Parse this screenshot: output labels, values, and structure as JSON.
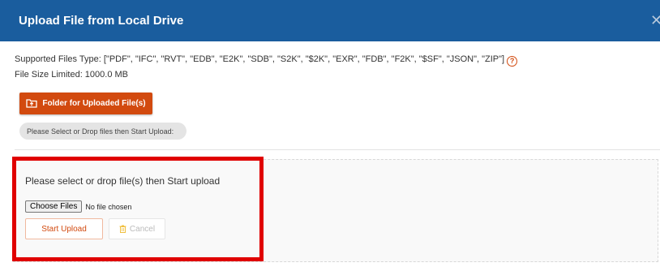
{
  "dialog": {
    "title": "Upload File from Local Drive",
    "close_glyph": "✕"
  },
  "info": {
    "supported_types": "Supported Files Type: [\"PDF\", \"IFC\", \"RVT\", \"EDB\", \"E2K\", \"SDB\", \"S2K\", \"$2K\", \"EXR\", \"FDB\", \"F2K\", \"$SF\", \"JSON\", \"ZIP\"]",
    "size_limit": "File Size Limited: 1000.0 MB",
    "help_glyph": "?"
  },
  "toolbar": {
    "folder_label": "Folder for Uploaded File(s)",
    "select_hint": "Please Select or Drop files then Start Upload:"
  },
  "drop_zone": {
    "prompt": "Please select or drop file(s) then Start upload",
    "choose_files_label": "Choose Files",
    "no_file_text": "No file chosen",
    "start_upload_label": "Start Upload",
    "cancel_label": "Cancel"
  },
  "colors": {
    "header_blue": "#1a5d9e",
    "accent_orange": "#d24a0f",
    "highlight_red": "#e00000"
  },
  "icons": [
    "close-icon",
    "help-icon",
    "folder-upload-icon",
    "trash-icon"
  ]
}
